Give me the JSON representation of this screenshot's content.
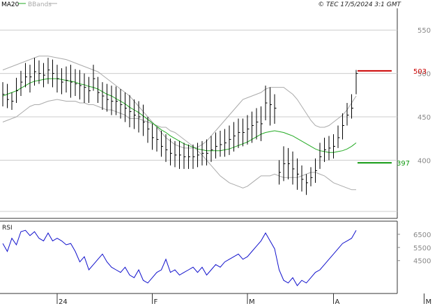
{
  "header": {
    "legend": [
      {
        "label": "MA20",
        "color": "#22aa22"
      },
      {
        "label": "BBands",
        "color": "#aaaaaa"
      }
    ],
    "timestamp": "© TEC 17/5/2024 3:1 GMT"
  },
  "colors": {
    "bars": "#000000",
    "ma": "#22aa22",
    "bands": "#aaaaaa",
    "rsi": "#1010cc",
    "grid": "#cccccc",
    "resistance": "#cc0000",
    "support": "#119911",
    "text": "#222222"
  },
  "chart_data": [
    {
      "type": "ohlc",
      "title": "",
      "ylim": [
        333,
        575
      ],
      "yticks": [
        "550",
        "500",
        "450",
        "400"
      ],
      "ytick_values": [
        550,
        500,
        450,
        400
      ],
      "grid": true,
      "x_labels": [
        "24",
        "F",
        "M",
        "A",
        "M"
      ],
      "x_label_bar_index": [
        12,
        33,
        54,
        73,
        93
      ],
      "levels": [
        {
          "label": "503",
          "value": 503,
          "color": "#cc0000"
        },
        {
          "label": "397",
          "value": 397,
          "color": "#119911"
        }
      ],
      "bars": {
        "high": [
          490,
          488,
          478,
          495,
          503,
          512,
          510,
          518,
          515,
          512,
          518,
          516,
          510,
          506,
          508,
          510,
          505,
          504,
          500,
          496,
          510,
          496,
          490,
          488,
          486,
          485,
          482,
          478,
          475,
          470,
          468,
          464,
          450,
          442,
          438,
          434,
          430,
          425,
          422,
          422,
          420,
          418,
          418,
          420,
          422,
          424,
          428,
          432,
          434,
          436,
          440,
          444,
          448,
          448,
          452,
          456,
          460,
          462,
          486,
          484,
          476,
          400,
          416,
          414,
          410,
          402,
          394,
          384,
          392,
          402,
          420,
          426,
          428,
          430,
          440,
          454,
          466,
          476,
          504
        ],
        "low": [
          462,
          460,
          458,
          466,
          474,
          484,
          478,
          486,
          488,
          484,
          488,
          484,
          478,
          476,
          478,
          472,
          474,
          470,
          466,
          466,
          480,
          466,
          458,
          456,
          452,
          452,
          448,
          444,
          438,
          436,
          432,
          428,
          420,
          412,
          410,
          404,
          398,
          394,
          392,
          390,
          390,
          390,
          390,
          392,
          394,
          394,
          398,
          402,
          404,
          404,
          406,
          410,
          414,
          416,
          418,
          420,
          424,
          422,
          446,
          440,
          442,
          372,
          376,
          378,
          372,
          366,
          364,
          360,
          370,
          374,
          390,
          398,
          400,
          402,
          414,
          424,
          440,
          448,
          476
        ],
        "close": [
          476,
          470,
          468,
          480,
          490,
          496,
          496,
          502,
          500,
          498,
          504,
          500,
          494,
          490,
          492,
          490,
          488,
          486,
          484,
          480,
          494,
          478,
          474,
          470,
          468,
          468,
          464,
          460,
          456,
          452,
          450,
          444,
          436,
          426,
          424,
          416,
          412,
          408,
          406,
          406,
          404,
          404,
          404,
          406,
          408,
          408,
          412,
          416,
          418,
          420,
          424,
          428,
          432,
          432,
          436,
          440,
          444,
          442,
          466,
          464,
          460,
          386,
          396,
          396,
          390,
          384,
          378,
          374,
          380,
          388,
          404,
          412,
          414,
          416,
          426,
          440,
          452,
          460,
          500
        ]
      },
      "ma20": [
        474,
        476,
        478,
        480,
        483,
        486,
        489,
        491,
        492,
        493,
        494,
        494,
        494,
        493,
        492,
        491,
        490,
        488,
        487,
        485,
        484,
        482,
        479,
        476,
        474,
        471,
        468,
        465,
        461,
        458,
        455,
        451,
        447,
        443,
        439,
        435,
        432,
        428,
        425,
        422,
        419,
        417,
        415,
        413,
        412,
        411,
        411,
        411,
        411,
        412,
        413,
        415,
        417,
        419,
        421,
        424,
        427,
        430,
        432,
        433,
        434,
        433,
        432,
        430,
        428,
        425,
        422,
        419,
        416,
        413,
        411,
        410,
        409,
        409,
        410,
        411,
        413,
        416,
        420
      ],
      "bb_upper": [
        504,
        506,
        508,
        510,
        512,
        514,
        516,
        518,
        520,
        520,
        520,
        519,
        518,
        517,
        516,
        514,
        512,
        510,
        508,
        506,
        504,
        502,
        498,
        494,
        490,
        486,
        482,
        478,
        474,
        468,
        462,
        456,
        450,
        444,
        438,
        432,
        426,
        422,
        418,
        416,
        414,
        414,
        414,
        415,
        418,
        422,
        428,
        434,
        440,
        446,
        452,
        458,
        464,
        470,
        472,
        474,
        476,
        478,
        482,
        484,
        484,
        484,
        484,
        480,
        476,
        470,
        462,
        454,
        446,
        440,
        438,
        438,
        440,
        444,
        448,
        452,
        458,
        466,
        474
      ],
      "bb_lower": [
        444,
        446,
        448,
        450,
        454,
        458,
        462,
        464,
        464,
        466,
        468,
        469,
        470,
        469,
        468,
        468,
        468,
        466,
        466,
        464,
        464,
        462,
        460,
        458,
        458,
        456,
        454,
        452,
        448,
        448,
        448,
        446,
        444,
        442,
        440,
        438,
        438,
        434,
        432,
        428,
        424,
        420,
        416,
        411,
        406,
        400,
        394,
        388,
        382,
        378,
        374,
        372,
        370,
        368,
        370,
        374,
        378,
        382,
        382,
        382,
        384,
        382,
        380,
        380,
        380,
        380,
        382,
        384,
        386,
        386,
        384,
        382,
        378,
        374,
        372,
        370,
        368,
        366,
        366
      ]
    },
    {
      "type": "line",
      "title": "RSI",
      "series": [
        {
          "name": "RSI",
          "values": [
            58,
            52,
            62,
            57,
            67,
            68,
            64,
            67,
            62,
            60,
            66,
            60,
            62,
            60,
            57,
            58,
            52,
            44,
            48,
            38,
            42,
            46,
            50,
            44,
            40,
            38,
            36,
            40,
            34,
            32,
            38,
            30,
            28,
            32,
            36,
            38,
            46,
            36,
            38,
            34,
            36,
            38,
            40,
            36,
            40,
            34,
            38,
            42,
            40,
            44,
            46,
            48,
            50,
            46,
            48,
            52,
            56,
            60,
            66,
            60,
            54,
            38,
            30,
            28,
            32,
            26,
            30,
            28,
            32,
            36,
            38,
            42,
            46,
            50,
            54,
            58,
            60,
            62,
            68
          ]
        }
      ],
      "ylim": [
        20,
        75
      ],
      "yticks": [
        "6500",
        "5500",
        "4500"
      ],
      "ytick_values": [
        65,
        55,
        45
      ],
      "grid": true
    }
  ]
}
